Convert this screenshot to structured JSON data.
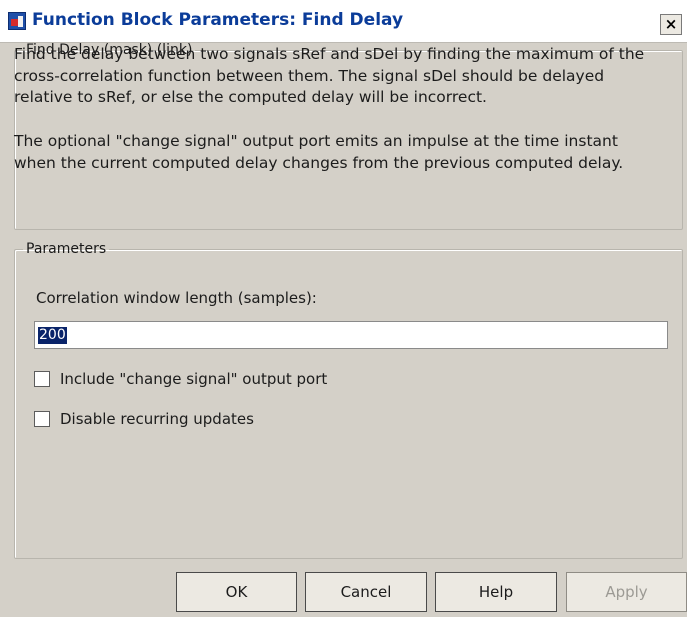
{
  "window": {
    "title": "Function Block Parameters: Find Delay",
    "close_label": "×"
  },
  "description": {
    "legend": "Find Delay (mask) (link)",
    "paragraph1": "Find the delay between two signals sRef and sDel by finding the maximum of the cross-correlation function between them.  The signal sDel should be delayed relative to sRef, or else the computed delay will be incorrect.",
    "paragraph2": "The optional \"change signal\" output port emits an impulse at the time instant when the current computed delay changes from the previous computed delay."
  },
  "parameters": {
    "legend": "Parameters",
    "correlation_label": "Correlation window length (samples):",
    "correlation_value": "200",
    "include_change_label": "Include \"change signal\" output port",
    "include_change_checked": false,
    "disable_updates_label": "Disable recurring updates",
    "disable_updates_checked": false
  },
  "buttons": {
    "ok": "OK",
    "cancel": "Cancel",
    "help": "Help",
    "apply": "Apply"
  }
}
